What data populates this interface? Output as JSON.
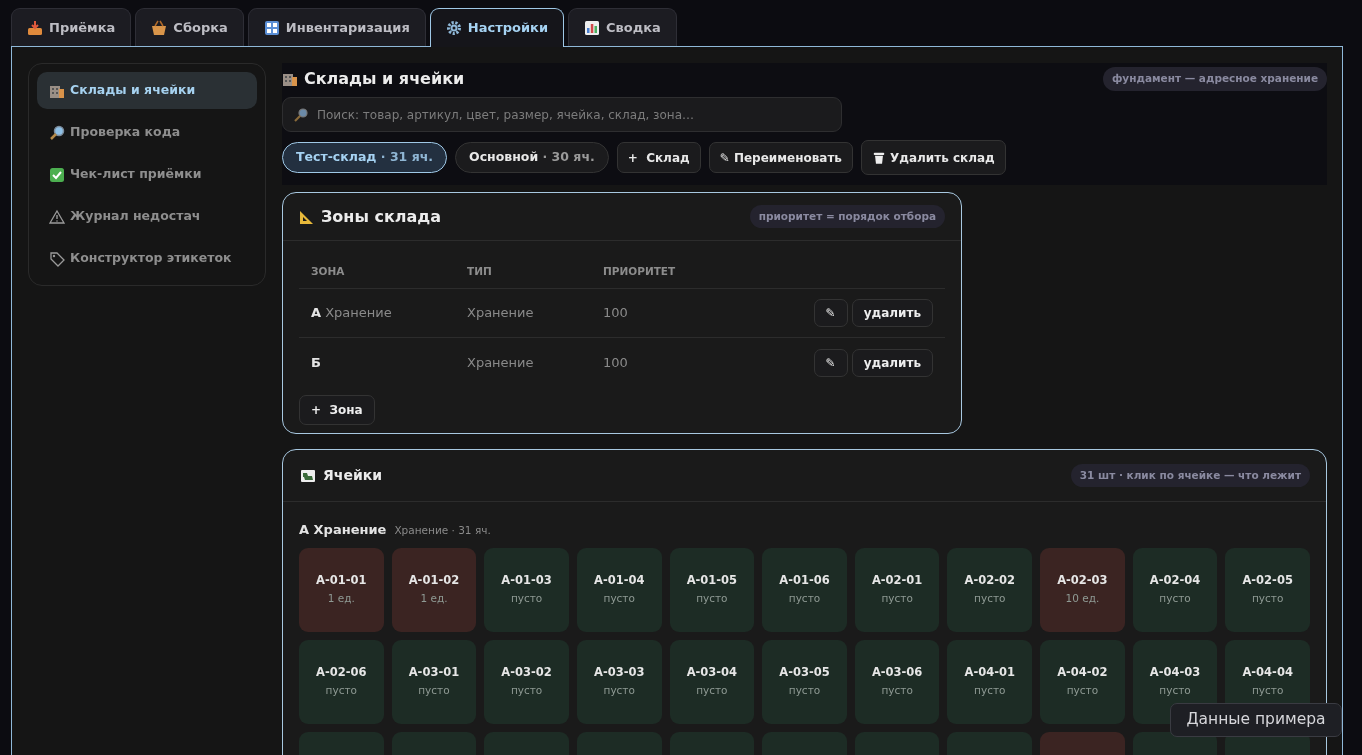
{
  "tabs": [
    {
      "label": "Приёмка",
      "selected": false
    },
    {
      "label": "Сборка",
      "selected": false
    },
    {
      "label": "Инвентаризация",
      "selected": false
    },
    {
      "label": "Настройки",
      "selected": true
    },
    {
      "label": "Сводка",
      "selected": false
    }
  ],
  "sidebar": {
    "items": [
      {
        "label": "Склады и ячейки",
        "selected": true
      },
      {
        "label": "Проверка кода",
        "selected": false
      },
      {
        "label": "Чек-лист приёмки",
        "selected": false
      },
      {
        "label": "Журнал недостач",
        "selected": false
      },
      {
        "label": "Конструктор этикеток",
        "selected": false
      }
    ]
  },
  "header": {
    "title": "Склады и ячейки",
    "badge": "фундамент — адресное хранение",
    "search": {
      "placeholder": "Поиск: товар, артикул, цвет, размер, ячейка, склад, зона…"
    },
    "warehouses": [
      {
        "name": "Тест-склад",
        "count": "· 31 яч.",
        "selected": true
      },
      {
        "name": "Основной",
        "count": "· 30 яч.",
        "selected": false
      }
    ],
    "actions": [
      {
        "label": "+  Склад",
        "kind": "text"
      },
      {
        "label": "✎ Переименовать",
        "kind": "text"
      },
      {
        "label": "Удалить склад",
        "kind": "trash"
      }
    ]
  },
  "zones": {
    "title": "Зоны склада",
    "badge": "приоритет = порядок отбора",
    "columns": [
      "ЗОНА",
      "ТИП",
      "ПРИОРИТЕТ"
    ],
    "rows": [
      {
        "zone": "А",
        "zone_note": "Хранение",
        "type": "Хранение",
        "priority": "100",
        "edit": "✎",
        "delete": "удалить"
      },
      {
        "zone": "Б",
        "type": "Хранение",
        "priority": "100",
        "edit": "✎",
        "delete": "удалить"
      }
    ],
    "add_button": "+  Зона"
  },
  "cells": {
    "title": "Ячейки",
    "badge": "31 шт · клик по ячейке — что лежит",
    "group": {
      "name": "А Хранение",
      "meta": "Хранение · 31 яч."
    },
    "items": [
      {
        "code": "А-01-01",
        "qty": "1 ед.",
        "filled": true
      },
      {
        "code": "А-01-02",
        "qty": "1 ед.",
        "filled": true
      },
      {
        "code": "А-01-03",
        "qty": "пусто",
        "filled": false
      },
      {
        "code": "А-01-04",
        "qty": "пусто",
        "filled": false
      },
      {
        "code": "А-01-05",
        "qty": "пусто",
        "filled": false
      },
      {
        "code": "А-01-06",
        "qty": "пусто",
        "filled": false
      },
      {
        "code": "А-02-01",
        "qty": "пусто",
        "filled": false
      },
      {
        "code": "А-02-02",
        "qty": "пусто",
        "filled": false
      },
      {
        "code": "А-02-03",
        "qty": "10 ед.",
        "filled": true
      },
      {
        "code": "А-02-04",
        "qty": "пусто",
        "filled": false
      },
      {
        "code": "А-02-05",
        "qty": "пусто",
        "filled": false
      },
      {
        "code": "А-02-06",
        "qty": "пусто",
        "filled": false
      },
      {
        "code": "А-03-01",
        "qty": "пусто",
        "filled": false
      },
      {
        "code": "А-03-02",
        "qty": "пусто",
        "filled": false
      },
      {
        "code": "А-03-03",
        "qty": "пусто",
        "filled": false
      },
      {
        "code": "А-03-04",
        "qty": "пусто",
        "filled": false
      },
      {
        "code": "А-03-05",
        "qty": "пусто",
        "filled": false
      },
      {
        "code": "А-03-06",
        "qty": "пусто",
        "filled": false
      },
      {
        "code": "А-04-01",
        "qty": "пусто",
        "filled": false
      },
      {
        "code": "А-04-02",
        "qty": "пусто",
        "filled": false
      },
      {
        "code": "А-04-03",
        "qty": "пусто",
        "filled": false
      },
      {
        "code": "А-04-04",
        "qty": "пусто",
        "filled": false
      },
      {
        "filled": false
      },
      {
        "filled": false
      },
      {
        "filled": false
      },
      {
        "filled": false
      },
      {
        "filled": false
      },
      {
        "filled": false
      },
      {
        "filled": false
      },
      {
        "filled": false
      },
      {
        "filled": true
      },
      {
        "filled": false
      },
      {
        "filled": false
      }
    ]
  },
  "toast": "Данные примера"
}
